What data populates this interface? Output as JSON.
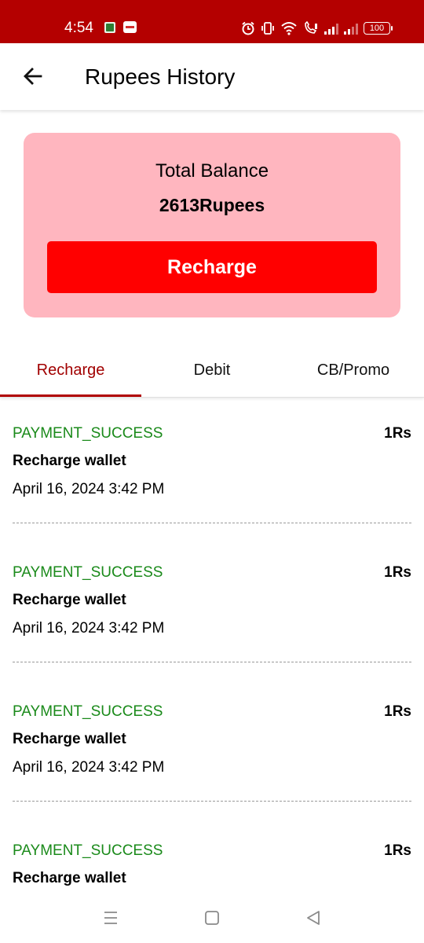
{
  "status_bar": {
    "time": "4:54",
    "battery": "100",
    "icons": [
      "gallery-app-icon",
      "news-app-icon",
      "alarm-icon",
      "vibrate-icon",
      "wifi-icon",
      "wifi-calling-icon",
      "signal-icon",
      "signal-icon-2",
      "battery-icon"
    ]
  },
  "header": {
    "title": "Rupees History",
    "back_icon": "arrow-left-icon"
  },
  "balance_card": {
    "label": "Total Balance",
    "value": "2613Rupees",
    "button_label": "Recharge"
  },
  "tabs": [
    {
      "label": "Recharge",
      "active": true
    },
    {
      "label": "Debit",
      "active": false
    },
    {
      "label": "CB/Promo",
      "active": false
    }
  ],
  "transactions": [
    {
      "status": "PAYMENT_SUCCESS",
      "amount": "1Rs",
      "title": "Recharge wallet",
      "date": "April 16, 2024 3:42 PM"
    },
    {
      "status": "PAYMENT_SUCCESS",
      "amount": "1Rs",
      "title": "Recharge wallet",
      "date": "April 16, 2024 3:42 PM"
    },
    {
      "status": "PAYMENT_SUCCESS",
      "amount": "1Rs",
      "title": "Recharge wallet",
      "date": "April 16, 2024 3:42 PM"
    },
    {
      "status": "PAYMENT_SUCCESS",
      "amount": "1Rs",
      "title": "Recharge wallet",
      "date": ""
    }
  ],
  "nav_bar": {
    "icons": [
      "menu-icon",
      "home-icon",
      "back-icon"
    ]
  },
  "colors": {
    "status_bar": "#b40000",
    "accent": "#ff0000",
    "card": "#ffb6bf",
    "success": "#1a8a1a",
    "active_tab": "#a10000"
  }
}
